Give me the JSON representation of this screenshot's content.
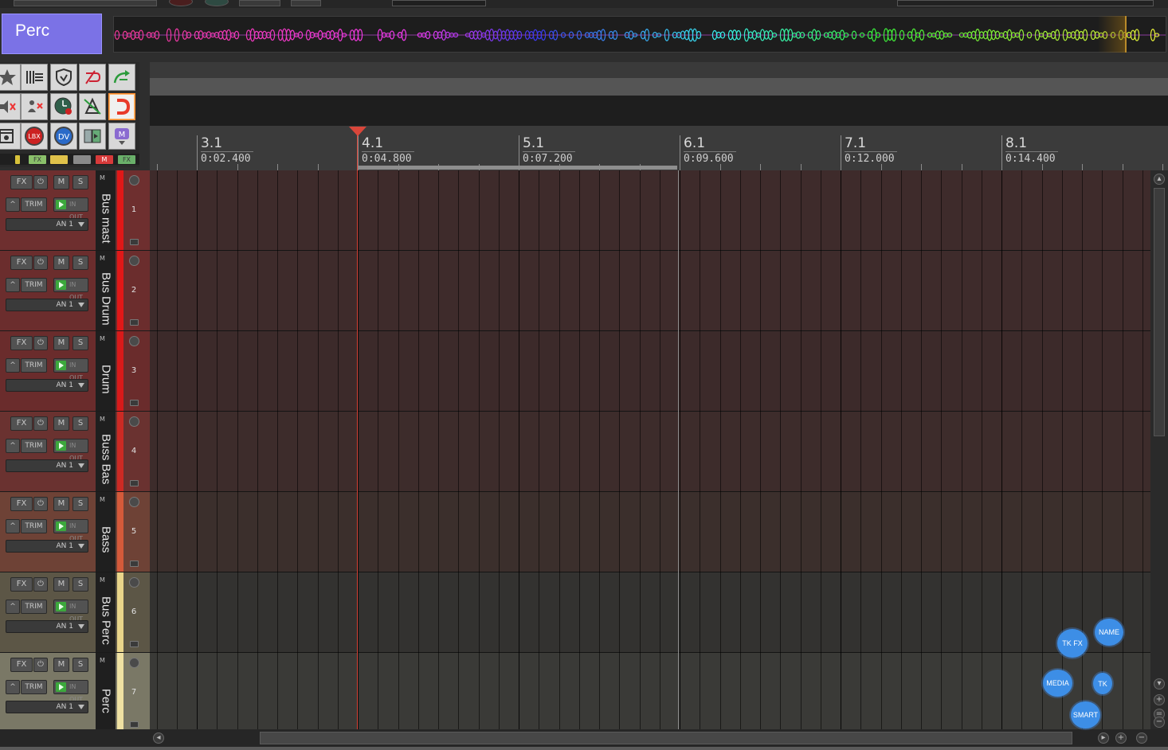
{
  "current_track": {
    "name": "Perc",
    "color": "#7b72e6"
  },
  "ruler": {
    "marks": [
      {
        "bar": "3.1",
        "time": "0:02.400"
      },
      {
        "bar": "4.1",
        "time": "0:04.800"
      },
      {
        "bar": "5.1",
        "time": "0:07.200"
      },
      {
        "bar": "6.1",
        "time": "0:09.600"
      },
      {
        "bar": "7.1",
        "time": "0:12.000"
      },
      {
        "bar": "8.1",
        "time": "0:14.400"
      }
    ]
  },
  "toolbar": {
    "icons": [
      "star-icon",
      "grid-icon",
      "shield-icon",
      "loop-off-icon",
      "loop-arrow-icon",
      "mute-x-icon",
      "mute-person-icon",
      "clock-icon",
      "ruler-tool-icon",
      "magnet-icon",
      "stack-icon",
      "lbx-icon",
      "dv-icon",
      "panel-icon",
      "m-dropdown-icon"
    ],
    "lbx_label": "LBX",
    "dv_label": "DV",
    "m_label": "M",
    "mini_labels": [
      "FX",
      "M",
      "FX"
    ]
  },
  "track_controls": {
    "fx_label": "FX",
    "power_label": "⏻",
    "mute_label": "M",
    "solo_label": "S",
    "env_label": "^",
    "trim_label": "TRIM",
    "io_label": "IN OUT",
    "channel_label": "AN 1",
    "mini_m_label": "M"
  },
  "tracks": [
    {
      "number": "1",
      "name": "Bus mast",
      "panel_color": "#6e2f2f",
      "lane_color": "#3e2b2b",
      "stripe_color": "#e01818"
    },
    {
      "number": "2",
      "name": "Bus Drum",
      "panel_color": "#6b2d2d",
      "lane_color": "#3e2b2b",
      "stripe_color": "#e01818"
    },
    {
      "number": "3",
      "name": "Drum",
      "panel_color": "#6a2c2c",
      "lane_color": "#3c2a2a",
      "stripe_color": "#d81a1a"
    },
    {
      "number": "4",
      "name": "Buss Bas",
      "panel_color": "#6a3230",
      "lane_color": "#3d2c2b",
      "stripe_color": "#cc2a24"
    },
    {
      "number": "5",
      "name": "Bass",
      "panel_color": "#6e4236",
      "lane_color": "#3b2f2c",
      "stripe_color": "#d45a3a"
    },
    {
      "number": "6",
      "name": "Bus Perc",
      "panel_color": "#5c5646",
      "lane_color": "#333230",
      "stripe_color": "#e9d58a"
    },
    {
      "number": "7",
      "name": "Perc",
      "panel_color": "#7a7866",
      "lane_color": "#3a3a37",
      "stripe_color": "#efe1a2"
    }
  ],
  "bubbles": [
    {
      "label": "NAME"
    },
    {
      "label": "TK FX"
    },
    {
      "label": "MEDIA"
    },
    {
      "label": "TK"
    },
    {
      "label": "SMART"
    }
  ],
  "colors": {
    "accent": "#3d8ee6",
    "cursor": "#d9463a"
  }
}
